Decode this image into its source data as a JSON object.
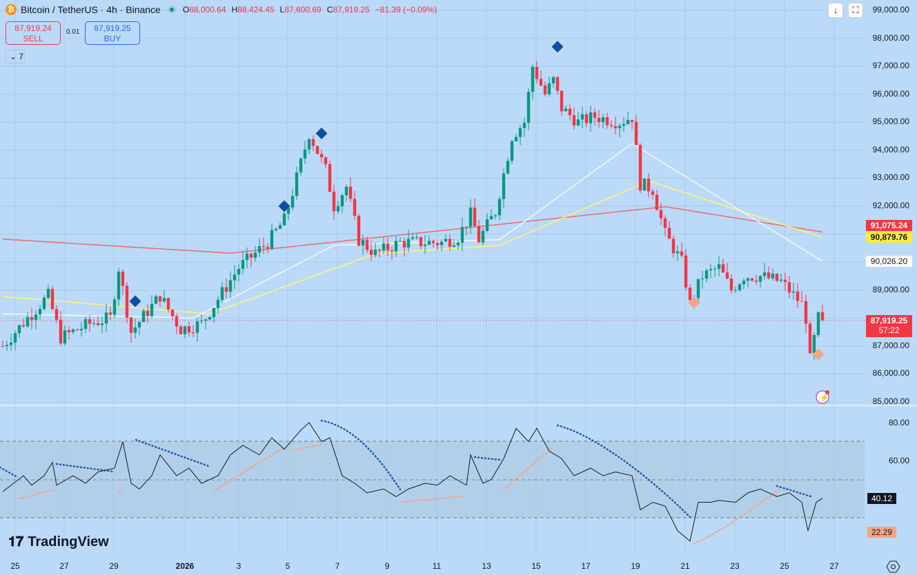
{
  "header": {
    "symbol": "Bitcoin / TetherUS · 4h · Binance",
    "open_label": "O",
    "open": "88,000.64",
    "high_label": "H",
    "high": "88,424.45",
    "low_label": "L",
    "low": "87,600.69",
    "close_label": "C",
    "close": "87,919.25",
    "change": "−81.39 (−0.09%)"
  },
  "trade": {
    "sell_price": "87,919.24",
    "sell_label": "SELL",
    "spread": "0.01",
    "buy_price": "87,919.25",
    "buy_label": "BUY"
  },
  "indicators_toggle": "7",
  "buttons": {
    "down": "↓",
    "fullscreen": "⛶"
  },
  "brand": "TradingView",
  "colors": {
    "bg": "#bbdaf9",
    "up": "#089981",
    "down": "#f23645",
    "ma_red": "#e57373",
    "ma_yellow": "#fff176",
    "ma_white": "#f5f5f5"
  },
  "price_axis": [
    "99,000.00",
    "98,000.00",
    "97,000.00",
    "96,000.00",
    "95,000.00",
    "94,000.00",
    "93,000.00",
    "92,000.00",
    "89,000.00",
    "87,000.00",
    "86,000.00",
    "85,000.00"
  ],
  "price_labels": {
    "ma_red": "91,075.24",
    "ma_yellow": "90,879.76",
    "ma_white": "90,026.20",
    "last": "87,919.25",
    "countdown": "57:22"
  },
  "rsi_axis": [
    "80.00",
    "60.00"
  ],
  "rsi_labels": {
    "rsi": "40.12",
    "signal": "22.29"
  },
  "time_axis": [
    "25",
    "27",
    "29",
    "2026",
    "3",
    "5",
    "7",
    "9",
    "11",
    "13",
    "15",
    "17",
    "19",
    "21",
    "23",
    "25",
    "27"
  ],
  "chart_data": {
    "type": "candlestick",
    "title": "Bitcoin / TetherUS · 4h · Binance",
    "ylim": [
      85000,
      99000
    ],
    "close_waypoints": [
      [
        0,
        87000
      ],
      [
        6,
        88000
      ],
      [
        11,
        88800
      ],
      [
        14,
        87300
      ],
      [
        21,
        87800
      ],
      [
        26,
        88000
      ],
      [
        28,
        89800
      ],
      [
        31,
        87500
      ],
      [
        38,
        88800
      ],
      [
        40,
        88300
      ],
      [
        43,
        87600
      ],
      [
        48,
        87800
      ],
      [
        53,
        88900
      ],
      [
        57,
        89800
      ],
      [
        64,
        90700
      ],
      [
        68,
        91500
      ],
      [
        71,
        93000
      ],
      [
        74,
        94600
      ],
      [
        78,
        93300
      ],
      [
        80,
        92000
      ],
      [
        83,
        92700
      ],
      [
        86,
        90800
      ],
      [
        90,
        90300
      ],
      [
        93,
        90500
      ],
      [
        96,
        90700
      ],
      [
        100,
        90700
      ],
      [
        106,
        90700
      ],
      [
        110,
        90900
      ],
      [
        113,
        91700
      ],
      [
        115,
        90800
      ],
      [
        119,
        91800
      ],
      [
        123,
        94500
      ],
      [
        126,
        95000
      ],
      [
        128,
        97000
      ],
      [
        131,
        96000
      ],
      [
        133,
        96500
      ],
      [
        135,
        95500
      ],
      [
        139,
        95000
      ],
      [
        143,
        95200
      ],
      [
        149,
        95000
      ],
      [
        152,
        95200
      ],
      [
        154,
        92800
      ],
      [
        157,
        92600
      ],
      [
        160,
        91000
      ],
      [
        164,
        90000
      ],
      [
        166,
        88500
      ],
      [
        169,
        89500
      ],
      [
        173,
        89800
      ],
      [
        176,
        89000
      ],
      [
        179,
        89500
      ],
      [
        183,
        89500
      ],
      [
        188,
        89300
      ],
      [
        193,
        88500
      ],
      [
        194,
        88000
      ],
      [
        195,
        86500
      ],
      [
        197,
        88000
      ],
      [
        198,
        87919.25
      ]
    ],
    "ma_series": [
      {
        "name": "MA red",
        "points": [
          [
            0,
            90820
          ],
          [
            55,
            90320
          ],
          [
            160,
            91980
          ],
          [
            198,
            91075.24
          ]
        ]
      },
      {
        "name": "MA yellow",
        "points": [
          [
            0,
            88770
          ],
          [
            50,
            88150
          ],
          [
            90,
            90300
          ],
          [
            120,
            90600
          ],
          [
            156,
            92900
          ],
          [
            198,
            90879.76
          ]
        ]
      },
      {
        "name": "MA white",
        "points": [
          [
            0,
            88150
          ],
          [
            46,
            88000
          ],
          [
            80,
            90600
          ],
          [
            120,
            90800
          ],
          [
            152,
            94240
          ],
          [
            198,
            90026.2
          ]
        ]
      }
    ],
    "markers": [
      [
        32,
        88600,
        "blue"
      ],
      [
        68,
        92000,
        "blue"
      ],
      [
        77,
        94600,
        "blue"
      ],
      [
        134,
        97700,
        "blue"
      ],
      [
        167,
        88550,
        "orange"
      ],
      [
        197,
        86700,
        "orange"
      ]
    ],
    "rsi": {
      "ylim": [
        15,
        85
      ],
      "bands": [
        70,
        50,
        30
      ],
      "points": [
        [
          0,
          43.6
        ],
        [
          2,
          47
        ],
        [
          5,
          52
        ],
        [
          7,
          47
        ],
        [
          10,
          52
        ],
        [
          12,
          59
        ],
        [
          13,
          47
        ],
        [
          17,
          52
        ],
        [
          20,
          48
        ],
        [
          23,
          54
        ],
        [
          27,
          56
        ],
        [
          29,
          70
        ],
        [
          31,
          48
        ],
        [
          33,
          45
        ],
        [
          36,
          52
        ],
        [
          38,
          63
        ],
        [
          42,
          52
        ],
        [
          45,
          56
        ],
        [
          48,
          48
        ],
        [
          52,
          52
        ],
        [
          55,
          63
        ],
        [
          58,
          68
        ],
        [
          62,
          63
        ],
        [
          65,
          72
        ],
        [
          68,
          66
        ],
        [
          72,
          76
        ],
        [
          74,
          80
        ],
        [
          77,
          70
        ],
        [
          79,
          72
        ],
        [
          82,
          52
        ],
        [
          85,
          48
        ],
        [
          88,
          43
        ],
        [
          92,
          45
        ],
        [
          95,
          41
        ],
        [
          98,
          45
        ],
        [
          102,
          48
        ],
        [
          105,
          47
        ],
        [
          108,
          52
        ],
        [
          112,
          47
        ],
        [
          113,
          63
        ],
        [
          116,
          48
        ],
        [
          118,
          50
        ],
        [
          121,
          61
        ],
        [
          124,
          77
        ],
        [
          127,
          70
        ],
        [
          129,
          77
        ],
        [
          132,
          65
        ],
        [
          135,
          61
        ],
        [
          138,
          52
        ],
        [
          142,
          56
        ],
        [
          145,
          52
        ],
        [
          148,
          54
        ],
        [
          152,
          52
        ],
        [
          154,
          34
        ],
        [
          157,
          38
        ],
        [
          160,
          36
        ],
        [
          163,
          23
        ],
        [
          166,
          17.5
        ],
        [
          168,
          38
        ],
        [
          171,
          38
        ],
        [
          173,
          39
        ],
        [
          177,
          38
        ],
        [
          180,
          43
        ],
        [
          183,
          45
        ],
        [
          187,
          41
        ],
        [
          190,
          43
        ],
        [
          193,
          38
        ],
        [
          194.5,
          23
        ],
        [
          196.5,
          38
        ],
        [
          198,
          40.12
        ]
      ]
    }
  }
}
